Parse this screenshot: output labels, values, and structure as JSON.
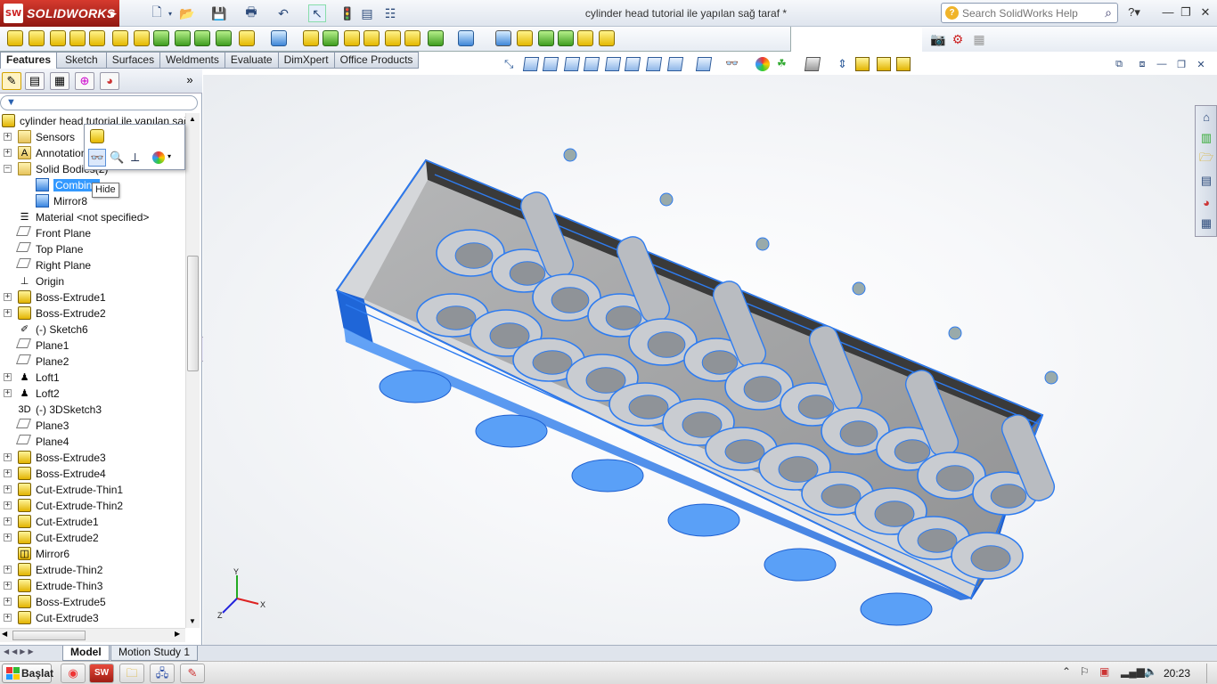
{
  "app": {
    "name": "SOLIDWORKS",
    "logo_mark": "SW"
  },
  "window": {
    "title": "cylinder head tutorial ile yapılan sağ taraf *"
  },
  "search": {
    "placeholder": "Search SolidWorks Help"
  },
  "command_manager": {
    "tabs": [
      {
        "label": "Features",
        "active": true
      },
      {
        "label": "Sketch"
      },
      {
        "label": "Surfaces"
      },
      {
        "label": "Weldments"
      },
      {
        "label": "Evaluate"
      },
      {
        "label": "DimXpert"
      },
      {
        "label": "Office Products"
      }
    ]
  },
  "feature_tree": {
    "root": "cylinder head tutorial ile yapılan sağ",
    "items": [
      {
        "label": "Sensors",
        "icon": "folder-icon"
      },
      {
        "label": "Annotations",
        "icon": "annotation-icon"
      },
      {
        "label": "Solid Bodies(2)",
        "icon": "folder-icon"
      },
      {
        "label": "Combine",
        "icon": "body-icon",
        "selected": true
      },
      {
        "label": "Mirror8",
        "icon": "body-icon"
      },
      {
        "label": "Material <not specified>",
        "icon": "material-icon"
      },
      {
        "label": "Front Plane",
        "icon": "plane-icon"
      },
      {
        "label": "Top Plane",
        "icon": "plane-icon"
      },
      {
        "label": "Right Plane",
        "icon": "plane-icon"
      },
      {
        "label": "Origin",
        "icon": "origin-icon"
      },
      {
        "label": "Boss-Extrude1",
        "icon": "feature-icon"
      },
      {
        "label": "Boss-Extrude2",
        "icon": "feature-icon"
      },
      {
        "label": "(-) Sketch6",
        "icon": "sketch-icon"
      },
      {
        "label": "Plane1",
        "icon": "plane-icon"
      },
      {
        "label": "Plane2",
        "icon": "plane-icon"
      },
      {
        "label": "Loft1",
        "icon": "loft-icon"
      },
      {
        "label": "Loft2",
        "icon": "loft-icon"
      },
      {
        "label": "(-) 3DSketch3",
        "icon": "sketch3d-icon"
      },
      {
        "label": "Plane3",
        "icon": "plane-icon"
      },
      {
        "label": "Plane4",
        "icon": "plane-icon"
      },
      {
        "label": "Boss-Extrude3",
        "icon": "feature-icon"
      },
      {
        "label": "Boss-Extrude4",
        "icon": "feature-icon"
      },
      {
        "label": "Cut-Extrude-Thin1",
        "icon": "feature-icon"
      },
      {
        "label": "Cut-Extrude-Thin2",
        "icon": "feature-icon"
      },
      {
        "label": "Cut-Extrude1",
        "icon": "feature-icon"
      },
      {
        "label": "Cut-Extrude2",
        "icon": "feature-icon"
      },
      {
        "label": "Mirror6",
        "icon": "mirror-icon"
      },
      {
        "label": "Extrude-Thin2",
        "icon": "feature-icon"
      },
      {
        "label": "Extrude-Thin3",
        "icon": "feature-icon"
      },
      {
        "label": "Boss-Extrude5",
        "icon": "feature-icon"
      },
      {
        "label": "Cut-Extrude3",
        "icon": "feature-icon"
      }
    ]
  },
  "tooltip": {
    "text": "Hide"
  },
  "triad": {
    "x": "X",
    "y": "Y",
    "z": "Z"
  },
  "bottom_tabs": [
    {
      "label": "Model",
      "active": true
    },
    {
      "label": "Motion Study 1"
    }
  ],
  "taskbar": {
    "start_label": "Başlat",
    "clock": "20:23"
  },
  "colors": {
    "model_blue": "#3a8cf5",
    "model_edge": "#1d5fd1",
    "selection": "#3399ff",
    "brand_red": "#c8261c"
  }
}
